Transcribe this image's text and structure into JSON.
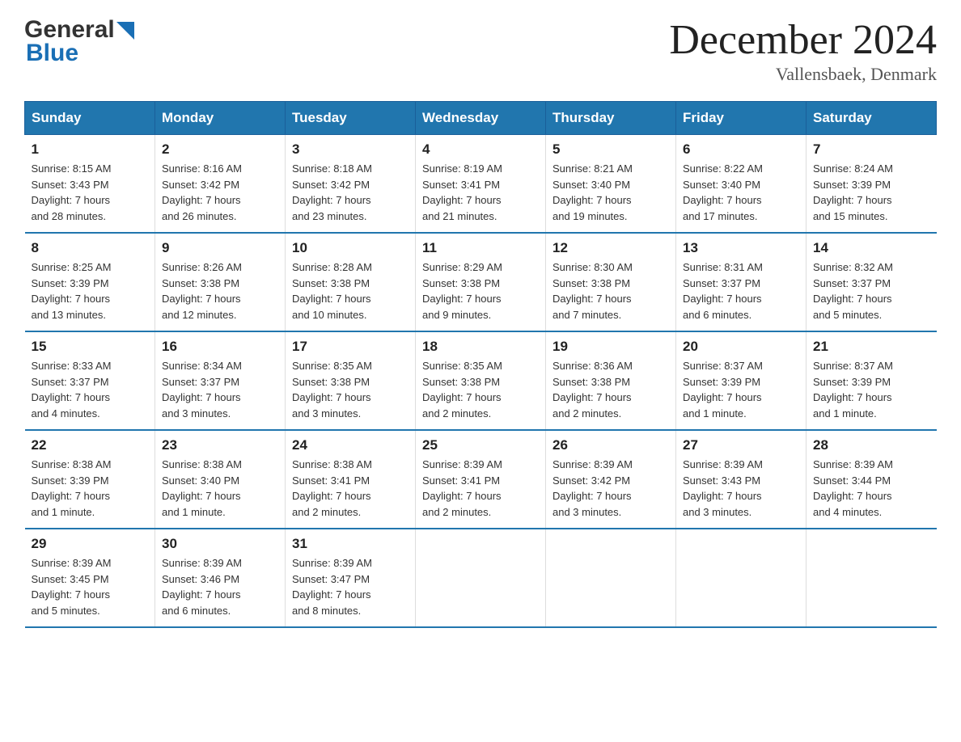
{
  "header": {
    "logo_general": "General",
    "logo_blue": "Blue",
    "month_year": "December 2024",
    "location": "Vallensbaek, Denmark"
  },
  "columns": [
    "Sunday",
    "Monday",
    "Tuesday",
    "Wednesday",
    "Thursday",
    "Friday",
    "Saturday"
  ],
  "weeks": [
    [
      {
        "day": "1",
        "sunrise": "Sunrise: 8:15 AM",
        "sunset": "Sunset: 3:43 PM",
        "daylight": "Daylight: 7 hours",
        "daylight2": "and 28 minutes."
      },
      {
        "day": "2",
        "sunrise": "Sunrise: 8:16 AM",
        "sunset": "Sunset: 3:42 PM",
        "daylight": "Daylight: 7 hours",
        "daylight2": "and 26 minutes."
      },
      {
        "day": "3",
        "sunrise": "Sunrise: 8:18 AM",
        "sunset": "Sunset: 3:42 PM",
        "daylight": "Daylight: 7 hours",
        "daylight2": "and 23 minutes."
      },
      {
        "day": "4",
        "sunrise": "Sunrise: 8:19 AM",
        "sunset": "Sunset: 3:41 PM",
        "daylight": "Daylight: 7 hours",
        "daylight2": "and 21 minutes."
      },
      {
        "day": "5",
        "sunrise": "Sunrise: 8:21 AM",
        "sunset": "Sunset: 3:40 PM",
        "daylight": "Daylight: 7 hours",
        "daylight2": "and 19 minutes."
      },
      {
        "day": "6",
        "sunrise": "Sunrise: 8:22 AM",
        "sunset": "Sunset: 3:40 PM",
        "daylight": "Daylight: 7 hours",
        "daylight2": "and 17 minutes."
      },
      {
        "day": "7",
        "sunrise": "Sunrise: 8:24 AM",
        "sunset": "Sunset: 3:39 PM",
        "daylight": "Daylight: 7 hours",
        "daylight2": "and 15 minutes."
      }
    ],
    [
      {
        "day": "8",
        "sunrise": "Sunrise: 8:25 AM",
        "sunset": "Sunset: 3:39 PM",
        "daylight": "Daylight: 7 hours",
        "daylight2": "and 13 minutes."
      },
      {
        "day": "9",
        "sunrise": "Sunrise: 8:26 AM",
        "sunset": "Sunset: 3:38 PM",
        "daylight": "Daylight: 7 hours",
        "daylight2": "and 12 minutes."
      },
      {
        "day": "10",
        "sunrise": "Sunrise: 8:28 AM",
        "sunset": "Sunset: 3:38 PM",
        "daylight": "Daylight: 7 hours",
        "daylight2": "and 10 minutes."
      },
      {
        "day": "11",
        "sunrise": "Sunrise: 8:29 AM",
        "sunset": "Sunset: 3:38 PM",
        "daylight": "Daylight: 7 hours",
        "daylight2": "and 9 minutes."
      },
      {
        "day": "12",
        "sunrise": "Sunrise: 8:30 AM",
        "sunset": "Sunset: 3:38 PM",
        "daylight": "Daylight: 7 hours",
        "daylight2": "and 7 minutes."
      },
      {
        "day": "13",
        "sunrise": "Sunrise: 8:31 AM",
        "sunset": "Sunset: 3:37 PM",
        "daylight": "Daylight: 7 hours",
        "daylight2": "and 6 minutes."
      },
      {
        "day": "14",
        "sunrise": "Sunrise: 8:32 AM",
        "sunset": "Sunset: 3:37 PM",
        "daylight": "Daylight: 7 hours",
        "daylight2": "and 5 minutes."
      }
    ],
    [
      {
        "day": "15",
        "sunrise": "Sunrise: 8:33 AM",
        "sunset": "Sunset: 3:37 PM",
        "daylight": "Daylight: 7 hours",
        "daylight2": "and 4 minutes."
      },
      {
        "day": "16",
        "sunrise": "Sunrise: 8:34 AM",
        "sunset": "Sunset: 3:37 PM",
        "daylight": "Daylight: 7 hours",
        "daylight2": "and 3 minutes."
      },
      {
        "day": "17",
        "sunrise": "Sunrise: 8:35 AM",
        "sunset": "Sunset: 3:38 PM",
        "daylight": "Daylight: 7 hours",
        "daylight2": "and 3 minutes."
      },
      {
        "day": "18",
        "sunrise": "Sunrise: 8:35 AM",
        "sunset": "Sunset: 3:38 PM",
        "daylight": "Daylight: 7 hours",
        "daylight2": "and 2 minutes."
      },
      {
        "day": "19",
        "sunrise": "Sunrise: 8:36 AM",
        "sunset": "Sunset: 3:38 PM",
        "daylight": "Daylight: 7 hours",
        "daylight2": "and 2 minutes."
      },
      {
        "day": "20",
        "sunrise": "Sunrise: 8:37 AM",
        "sunset": "Sunset: 3:39 PM",
        "daylight": "Daylight: 7 hours",
        "daylight2": "and 1 minute."
      },
      {
        "day": "21",
        "sunrise": "Sunrise: 8:37 AM",
        "sunset": "Sunset: 3:39 PM",
        "daylight": "Daylight: 7 hours",
        "daylight2": "and 1 minute."
      }
    ],
    [
      {
        "day": "22",
        "sunrise": "Sunrise: 8:38 AM",
        "sunset": "Sunset: 3:39 PM",
        "daylight": "Daylight: 7 hours",
        "daylight2": "and 1 minute."
      },
      {
        "day": "23",
        "sunrise": "Sunrise: 8:38 AM",
        "sunset": "Sunset: 3:40 PM",
        "daylight": "Daylight: 7 hours",
        "daylight2": "and 1 minute."
      },
      {
        "day": "24",
        "sunrise": "Sunrise: 8:38 AM",
        "sunset": "Sunset: 3:41 PM",
        "daylight": "Daylight: 7 hours",
        "daylight2": "and 2 minutes."
      },
      {
        "day": "25",
        "sunrise": "Sunrise: 8:39 AM",
        "sunset": "Sunset: 3:41 PM",
        "daylight": "Daylight: 7 hours",
        "daylight2": "and 2 minutes."
      },
      {
        "day": "26",
        "sunrise": "Sunrise: 8:39 AM",
        "sunset": "Sunset: 3:42 PM",
        "daylight": "Daylight: 7 hours",
        "daylight2": "and 3 minutes."
      },
      {
        "day": "27",
        "sunrise": "Sunrise: 8:39 AM",
        "sunset": "Sunset: 3:43 PM",
        "daylight": "Daylight: 7 hours",
        "daylight2": "and 3 minutes."
      },
      {
        "day": "28",
        "sunrise": "Sunrise: 8:39 AM",
        "sunset": "Sunset: 3:44 PM",
        "daylight": "Daylight: 7 hours",
        "daylight2": "and 4 minutes."
      }
    ],
    [
      {
        "day": "29",
        "sunrise": "Sunrise: 8:39 AM",
        "sunset": "Sunset: 3:45 PM",
        "daylight": "Daylight: 7 hours",
        "daylight2": "and 5 minutes."
      },
      {
        "day": "30",
        "sunrise": "Sunrise: 8:39 AM",
        "sunset": "Sunset: 3:46 PM",
        "daylight": "Daylight: 7 hours",
        "daylight2": "and 6 minutes."
      },
      {
        "day": "31",
        "sunrise": "Sunrise: 8:39 AM",
        "sunset": "Sunset: 3:47 PM",
        "daylight": "Daylight: 7 hours",
        "daylight2": "and 8 minutes."
      },
      null,
      null,
      null,
      null
    ]
  ]
}
